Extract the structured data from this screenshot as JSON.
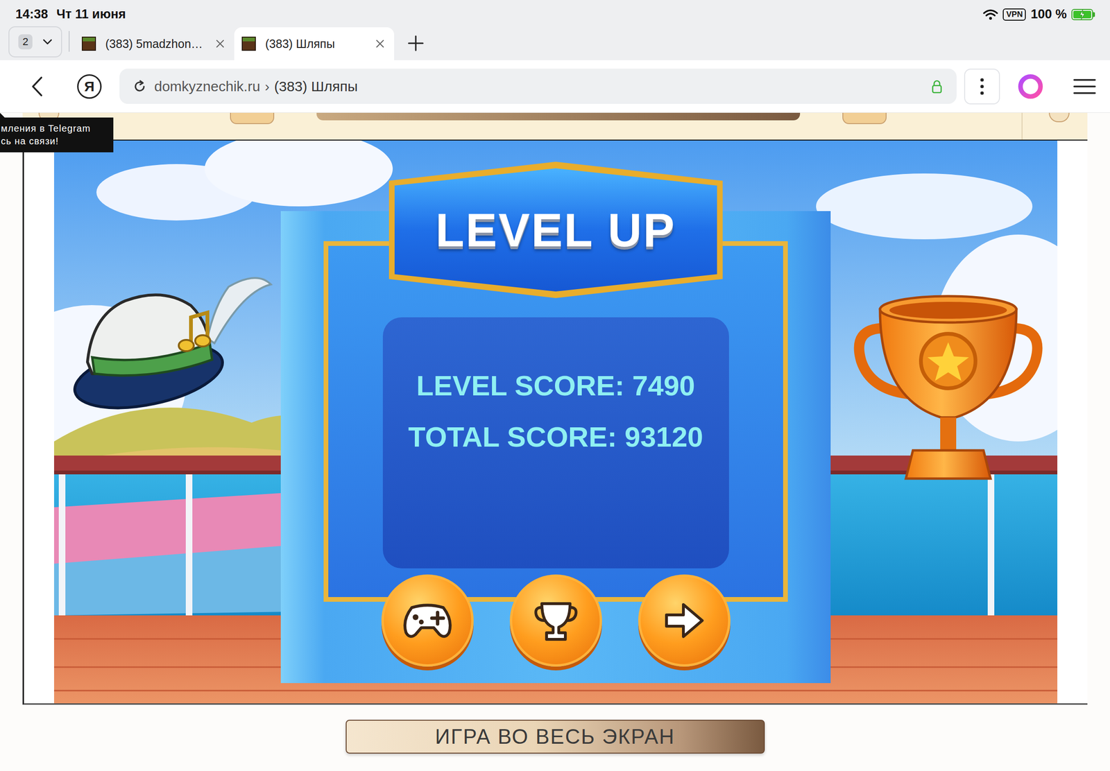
{
  "status_bar": {
    "time": "14:38",
    "date": "Чт 11 июня",
    "vpn": "VPN",
    "battery": "100 %",
    "battery_level": 1,
    "charging": true
  },
  "tab_bar": {
    "count": "2",
    "tabs": [
      {
        "label": "(383) 5madzhon…",
        "selected": false
      },
      {
        "label": "(383) Шляпы",
        "selected": true
      }
    ]
  },
  "address_bar": {
    "logo": "Я",
    "domain": "domkyznechik.ru",
    "separator": "›",
    "page_title": "(383) Шляпы"
  },
  "tooltip": {
    "lines": [
      "мления в Telegram",
      "сь на связи!"
    ]
  },
  "game": {
    "title": "LEVEL UP",
    "scores": [
      "LEVEL SCORE: 7490",
      "TOTAL SCORE: 93120"
    ],
    "buttons": [
      {
        "kind": "play"
      },
      {
        "kind": "leaderboard"
      },
      {
        "kind": "next"
      }
    ]
  },
  "fullscreen_button": "ИГРА ВО ВЕСЬ ЭКРАН"
}
